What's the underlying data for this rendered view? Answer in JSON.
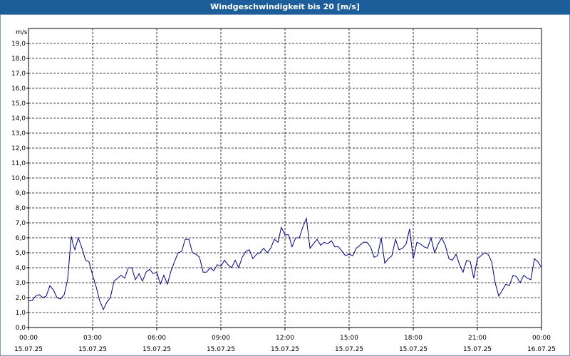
{
  "window": {
    "title": "Windgeschwindigkeit bis 20 [m/s]"
  },
  "chart_data": {
    "type": "line",
    "title": "Windgeschwindigkeit bis 20 [m/s]",
    "ylabel": "m/s",
    "ylim": [
      0,
      20
    ],
    "xlim": [
      "15.07.25 00:00",
      "16.07.25 00:00"
    ],
    "grid": true,
    "yticks": [
      "0,0",
      "1,0",
      "2,0",
      "3,0",
      "4,0",
      "5,0",
      "6,0",
      "7,0",
      "8,0",
      "9,0",
      "10,0",
      "11,0",
      "12,0",
      "13,0",
      "14,0",
      "15,0",
      "16,0",
      "17,0",
      "18,0",
      "19,0"
    ],
    "xticks": [
      {
        "time": "00:00",
        "date": "15.07.25"
      },
      {
        "time": "03:00",
        "date": "15.07.25"
      },
      {
        "time": "06:00",
        "date": "15.07.25"
      },
      {
        "time": "09:00",
        "date": "15.07.25"
      },
      {
        "time": "12:00",
        "date": "15.07.25"
      },
      {
        "time": "15:00",
        "date": "15.07.25"
      },
      {
        "time": "18:00",
        "date": "15.07.25"
      },
      {
        "time": "21:00",
        "date": "15.07.25"
      },
      {
        "time": "00:00",
        "date": "16.07.25"
      }
    ],
    "line_color": "#000080",
    "series": [
      {
        "x_hours": [
          0,
          0.17,
          0.33,
          0.5,
          0.67,
          0.83,
          1,
          1.17,
          1.33,
          1.5,
          1.67,
          1.83,
          2,
          2.08,
          2.17,
          2.33,
          2.5,
          2.67,
          2.83,
          3,
          3.17,
          3.33,
          3.5,
          3.67,
          3.83,
          4,
          4.17,
          4.33,
          4.5,
          4.67,
          4.83,
          5,
          5.17,
          5.33,
          5.5,
          5.67,
          5.83,
          6,
          6.17,
          6.33,
          6.5,
          6.67,
          6.83,
          7,
          7.17,
          7.33,
          7.5,
          7.67,
          7.83,
          8,
          8.17,
          8.33,
          8.5,
          8.67,
          8.83,
          9,
          9.17,
          9.33,
          9.5,
          9.67,
          9.83,
          10,
          10.17,
          10.33,
          10.5,
          10.67,
          10.83,
          11,
          11.17,
          11.33,
          11.5,
          11.67,
          11.83,
          12,
          12.17,
          12.33,
          12.5,
          12.67,
          12.83,
          13,
          13.17,
          13.33,
          13.5,
          13.67,
          13.83,
          14,
          14.17,
          14.33,
          14.5,
          14.67,
          14.83,
          15,
          15.17,
          15.33,
          15.5,
          15.67,
          15.83,
          16,
          16.17,
          16.33,
          16.5,
          16.67,
          16.83,
          17,
          17.17,
          17.33,
          17.5,
          17.67,
          17.83,
          18,
          18.17,
          18.33,
          18.5,
          18.67,
          18.83,
          19,
          19.17,
          19.33,
          19.5,
          19.67,
          19.83,
          20,
          20.17,
          20.33,
          20.5,
          20.67,
          20.83,
          21,
          21.17,
          21.33,
          21.5,
          21.67,
          21.83,
          22,
          22.17,
          22.33,
          22.5,
          22.67,
          22.83,
          23,
          23.17,
          23.33,
          23.5,
          23.67,
          23.83,
          24
        ],
        "values": [
          1.8,
          1.8,
          2.1,
          2.2,
          2.0,
          2.1,
          2.8,
          2.5,
          2.0,
          1.9,
          2.2,
          3.2,
          6.1,
          5.6,
          5.2,
          6.0,
          5.3,
          4.5,
          4.4,
          3.5,
          2.7,
          1.8,
          1.2,
          1.7,
          2.0,
          3.1,
          3.3,
          3.5,
          3.3,
          4.0,
          4.0,
          3.2,
          3.6,
          3.1,
          3.7,
          3.9,
          3.6,
          3.7,
          2.9,
          3.5,
          2.9,
          3.8,
          4.4,
          5.0,
          5.1,
          5.9,
          5.9,
          5.0,
          4.9,
          4.7,
          3.7,
          3.7,
          4.0,
          3.8,
          4.2,
          4.1,
          4.5,
          4.2,
          4.0,
          4.5,
          4.0,
          4.7,
          5.1,
          5.2,
          4.6,
          4.9,
          5.0,
          5.3,
          5.0,
          5.3,
          5.9,
          5.7,
          6.7,
          6.2,
          6.2,
          5.4,
          6.0,
          6.0,
          6.7,
          7.3,
          5.3,
          5.6,
          5.9,
          5.5,
          5.7,
          5.6,
          5.8,
          5.4,
          5.4,
          5.1,
          4.8,
          4.9,
          4.8,
          5.3,
          5.5,
          5.7,
          5.7,
          5.4,
          4.7,
          4.8,
          6.0,
          4.3,
          4.6,
          4.8,
          5.9,
          5.2,
          5.3,
          5.6,
          6.6,
          4.6,
          5.7,
          5.6,
          5.4,
          5.3,
          6.0,
          5.0,
          5.6,
          6.0,
          5.5,
          4.6,
          4.5,
          4.9,
          4.2,
          3.7,
          4.5,
          4.4,
          3.3,
          4.6,
          4.8,
          5.0,
          4.9,
          4.4,
          3.0,
          2.1,
          2.5,
          2.9,
          2.8,
          3.5,
          3.4,
          3.0,
          3.5,
          3.3,
          3.2,
          4.6,
          4.4,
          4.0
        ]
      }
    ]
  }
}
